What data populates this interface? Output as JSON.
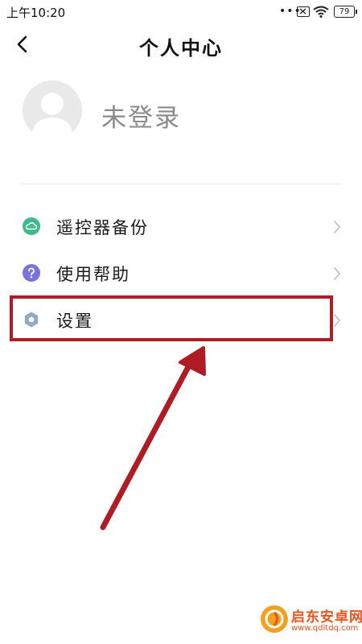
{
  "status_bar": {
    "time": "上午10:20",
    "dots": "•••",
    "battery": "79"
  },
  "header": {
    "title": "个人中心",
    "back_icon": "chevron-left-icon"
  },
  "profile": {
    "login_status": "未登录",
    "avatar_icon": "default-avatar-icon"
  },
  "menu": {
    "items": [
      {
        "label": "遥控器备份",
        "icon": "cloud-icon",
        "color": "#3dbb8b"
      },
      {
        "label": "使用帮助",
        "icon": "question-icon",
        "color": "#7b74dd"
      },
      {
        "label": "设置",
        "icon": "hexagon-gear-icon",
        "color": "#8fa8cc"
      }
    ]
  },
  "annotation": {
    "highlight_color": "#b01c24",
    "highlight_target": "设置"
  },
  "watermark": {
    "title": "启东安卓网",
    "url": "www.qdltdq.com"
  }
}
